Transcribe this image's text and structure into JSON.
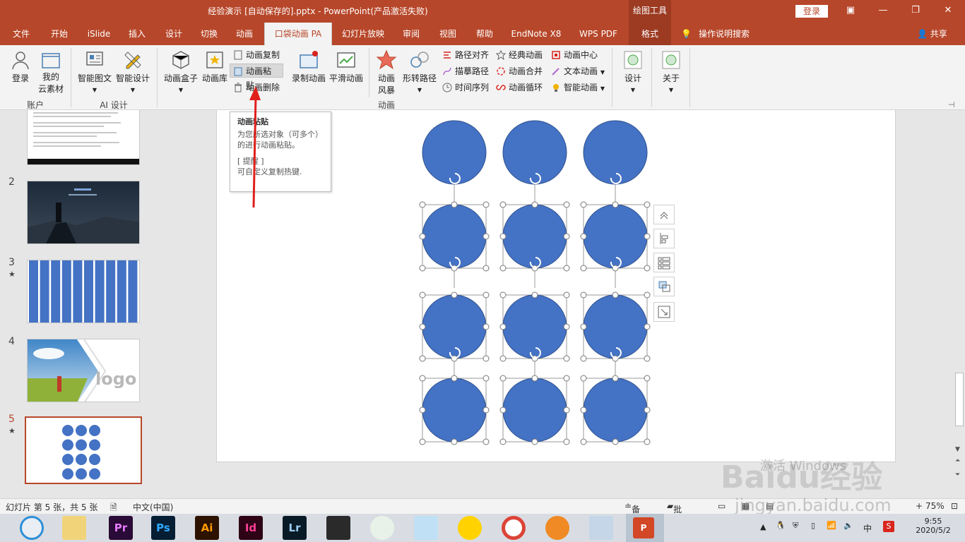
{
  "window": {
    "title": "经验演示 [自动保存的].pptx  -  PowerPoint(产品激活失败)",
    "context_group": "绘图工具",
    "login_label": "登录"
  },
  "tabs": [
    "文件",
    "开始",
    "iSlide",
    "插入",
    "设计",
    "切换",
    "动画",
    "口袋动画 PA",
    "幻灯片放映",
    "审阅",
    "视图",
    "帮助",
    "EndNote X8",
    "WPS PDF",
    "格式"
  ],
  "active_tab": "口袋动画 PA",
  "tell_me": "操作说明搜索",
  "share": "共享",
  "ribbon": {
    "account": {
      "login": "登录",
      "cloud_line1": "我的",
      "cloud_line2": "云素材",
      "group": "账户"
    },
    "ai": {
      "smart_text": "智能图文",
      "smart_design": "智能设计",
      "group": "AI 设计"
    },
    "animation": {
      "box": "动画盒子",
      "library": "动画库",
      "copy": "动画复制",
      "paste": "动画粘贴",
      "delete": "动画删除",
      "record": "录制动画",
      "smooth": "平滑动画",
      "storm_line1": "动画",
      "storm_line2": "风暴",
      "shape_path": "形转路径",
      "path_align": "路径对齐",
      "trace_path": "描摹路径",
      "timeline": "时间序列",
      "classic": "经典动画",
      "merge": "动画合并",
      "loop": "动画循环",
      "center": "动画中心",
      "text_anim": "文本动画",
      "smart_anim": "智能动画",
      "group": "动画"
    },
    "design": "设计",
    "about": "关于"
  },
  "tooltip": {
    "title": "动画粘贴",
    "body": "为您所选对象（可多个）的进行动画粘贴。",
    "tip_head": "[ 提醒 ]",
    "tip_body": "可自定义复制热键."
  },
  "slides": [
    {
      "num": "",
      "star": ""
    },
    {
      "num": "2",
      "star": ""
    },
    {
      "num": "3",
      "star": "★"
    },
    {
      "num": "4",
      "star": ""
    },
    {
      "num": "5",
      "star": "★"
    }
  ],
  "thumb4_logo": "logo",
  "status": {
    "slide_info": "幻灯片 第 5 张，共 5 张",
    "language": "中文(中国)",
    "notes": "备注",
    "comments": "批注",
    "zoom": "75%"
  },
  "taskbar": {
    "apps": [
      "Pr",
      "Ps",
      "Ai",
      "Id",
      "Lr"
    ],
    "time": "9:55",
    "date": "2020/5/2",
    "ime": "中"
  },
  "watermark": {
    "brand": "Baidu经验",
    "url": "jingyan.baidu.com",
    "activate": "激活 Windows"
  },
  "colors": {
    "accent": "#b7472a",
    "circle": "#4472c4",
    "circle_border": "#2f528f"
  }
}
